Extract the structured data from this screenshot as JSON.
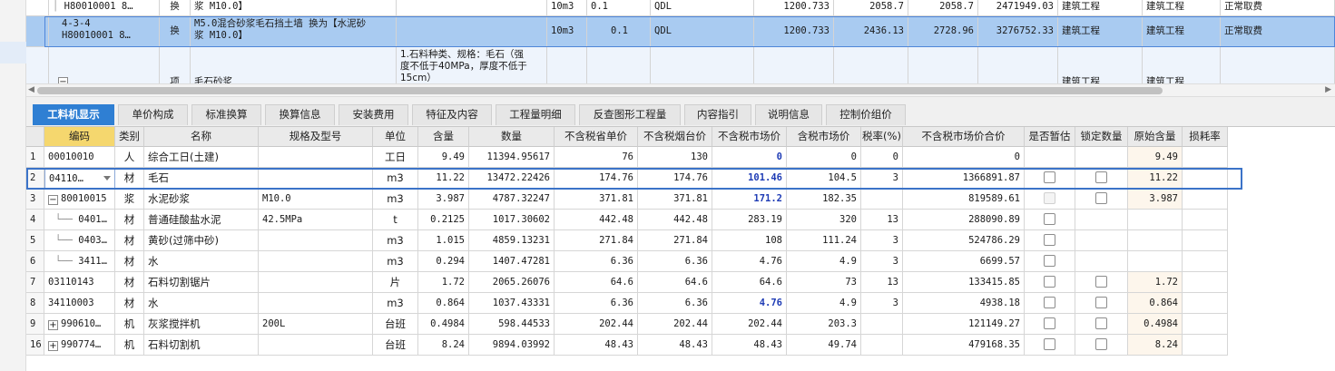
{
  "top_rows": [
    {
      "code_line1": "",
      "code_line2": "H80010001 8…",
      "type": "换",
      "name": "浆 M10.0】",
      "unit": "10m3",
      "qty": "0.1",
      "expr": "QDL",
      "price1": "1200.733",
      "price2": "2058.7",
      "price3": "2058.7",
      "total": "2471949.03",
      "cat1": "建筑工程",
      "cat2": "建筑工程",
      "fee": "正常取费"
    },
    {
      "code_line1": "4-3-4",
      "code_line2": "H80010001 8…",
      "type": "换",
      "name_line1": "M5.0混合砂浆毛石挡土墙  换为【水泥砂",
      "name_line2": "浆 M10.0】",
      "unit": "10m3",
      "qty": "0.1",
      "expr": "QDL",
      "price1": "1200.733",
      "price2": "2436.13",
      "price3": "2728.96",
      "total": "3276752.33",
      "cat1": "建筑工程",
      "cat2": "建筑工程",
      "fee": "正常取费"
    },
    {
      "feature_line1": "1.石料种类、规格：毛石（强",
      "feature_line2": "度不低于40MPa，厚度不低于",
      "feature_line3": "15cm）",
      "type": "项",
      "name": "毛石砂浆",
      "cat1": "建筑工程",
      "cat2": "建筑工程"
    }
  ],
  "tabs": [
    {
      "label": "工料机显示",
      "active": true
    },
    {
      "label": "单价构成"
    },
    {
      "label": "标准换算"
    },
    {
      "label": "换算信息"
    },
    {
      "label": "安装费用"
    },
    {
      "label": "特征及内容"
    },
    {
      "label": "工程量明细"
    },
    {
      "label": "反查图形工程量"
    },
    {
      "label": "内容指引"
    },
    {
      "label": "说明信息"
    },
    {
      "label": "控制价组价"
    }
  ],
  "columns": [
    "",
    "编码",
    "类别",
    "名称",
    "规格及型号",
    "单位",
    "含量",
    "数量",
    "不含税省单价",
    "不含税烟台价",
    "不含税市场价",
    "含税市场价",
    "税率(%)",
    "不含税市场价合价",
    "是否暂估",
    "锁定数量",
    "原始含量",
    "损耗率"
  ],
  "rows": [
    {
      "n": "1",
      "code": "00010010",
      "kind": "人",
      "name": "综合工日(土建)",
      "spec": "",
      "unit": "工日",
      "content": "9.49",
      "qty": "11394.95617",
      "p1": "76",
      "p2": "130",
      "p3": "0",
      "p3blue": true,
      "p4": "0",
      "tax": "0",
      "sum": "0",
      "cb1": false,
      "cb2": false,
      "orig": "9.49",
      "loss": ""
    },
    {
      "n": "2",
      "code": "04110…",
      "kind": "材",
      "name": "毛石",
      "spec": "",
      "unit": "m3",
      "content": "11.22",
      "qty": "13472.22426",
      "p1": "174.76",
      "p2": "174.76",
      "p3": "101.46",
      "p3blue": true,
      "p4": "104.5",
      "tax": "3",
      "sum": "1366891.87",
      "cb1": true,
      "cb2": true,
      "orig": "11.22",
      "loss": "",
      "selected": true
    },
    {
      "n": "3",
      "code": "80010015",
      "expand": "−",
      "kind": "浆",
      "name": "水泥砂浆",
      "spec": "M10.0",
      "unit": "m3",
      "content": "3.987",
      "qty": "4787.32247",
      "p1": "371.81",
      "p2": "371.81",
      "p3": "171.2",
      "p3blue": true,
      "p4": "182.35",
      "tax": "",
      "sum": "819589.61",
      "cb1": true,
      "cb1dis": true,
      "cb2": true,
      "orig": "3.987",
      "loss": ""
    },
    {
      "n": "4",
      "code": "0401…",
      "tree": true,
      "kind": "材",
      "name": "普通硅酸盐水泥",
      "spec": "42.5MPa",
      "unit": "t",
      "content": "0.2125",
      "qty": "1017.30602",
      "p1": "442.48",
      "p2": "442.48",
      "p3": "283.19",
      "p4": "320",
      "tax": "13",
      "sum": "288090.89",
      "cb1": true,
      "cb2": false,
      "orig": "",
      "loss": ""
    },
    {
      "n": "5",
      "code": "0403…",
      "tree": true,
      "kind": "材",
      "name": "黄砂(过筛中砂)",
      "spec": "",
      "unit": "m3",
      "content": "1.015",
      "qty": "4859.13231",
      "p1": "271.84",
      "p2": "271.84",
      "p3": "108",
      "p4": "111.24",
      "tax": "3",
      "sum": "524786.29",
      "cb1": true,
      "cb2": false,
      "orig": "",
      "loss": ""
    },
    {
      "n": "6",
      "code": "3411…",
      "tree": true,
      "kind": "材",
      "name": "水",
      "spec": "",
      "unit": "m3",
      "content": "0.294",
      "qty": "1407.47281",
      "p1": "6.36",
      "p2": "6.36",
      "p3": "4.76",
      "p4": "4.9",
      "tax": "3",
      "sum": "6699.57",
      "cb1": true,
      "cb2": false,
      "orig": "",
      "loss": ""
    },
    {
      "n": "7",
      "code": "03110143",
      "kind": "材",
      "name": "石料切割锯片",
      "spec": "",
      "unit": "片",
      "content": "1.72",
      "qty": "2065.26076",
      "p1": "64.6",
      "p2": "64.6",
      "p3": "64.6",
      "p4": "73",
      "tax": "13",
      "sum": "133415.85",
      "cb1": true,
      "cb2": true,
      "orig": "1.72",
      "loss": ""
    },
    {
      "n": "8",
      "code": "34110003",
      "kind": "材",
      "name": "水",
      "spec": "",
      "unit": "m3",
      "content": "0.864",
      "qty": "1037.43331",
      "p1": "6.36",
      "p2": "6.36",
      "p3": "4.76",
      "p3blue": true,
      "p4": "4.9",
      "tax": "3",
      "sum": "4938.18",
      "cb1": true,
      "cb2": true,
      "orig": "0.864",
      "loss": ""
    },
    {
      "n": "9",
      "code": "990610…",
      "expand": "+",
      "kind": "机",
      "name": "灰浆搅拌机",
      "spec": "200L",
      "unit": "台班",
      "content": "0.4984",
      "qty": "598.44533",
      "p1": "202.44",
      "p2": "202.44",
      "p3": "202.44",
      "p4": "203.3",
      "tax": "",
      "sum": "121149.27",
      "cb1": true,
      "cb2": true,
      "orig": "0.4984",
      "loss": ""
    },
    {
      "n": "16",
      "code": "990774…",
      "expand": "+",
      "kind": "机",
      "name": "石料切割机",
      "spec": "",
      "unit": "台班",
      "content": "8.24",
      "qty": "9894.03992",
      "p1": "48.43",
      "p2": "48.43",
      "p3": "48.43",
      "p4": "49.74",
      "tax": "",
      "sum": "479168.35",
      "cb1": true,
      "cb2": true,
      "orig": "8.24",
      "loss": ""
    }
  ]
}
